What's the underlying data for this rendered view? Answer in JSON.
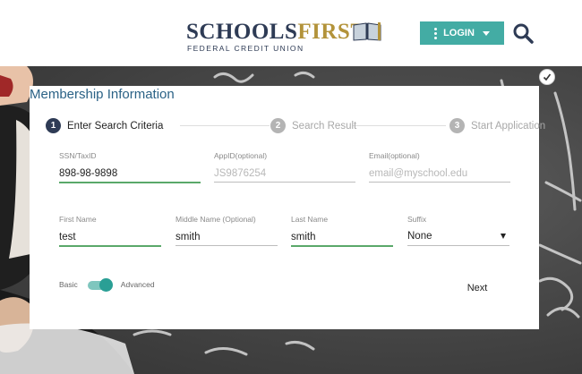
{
  "brand": {
    "name_part1": "SCHOOLS",
    "name_part2": "FIRST",
    "subtitle": "FEDERAL CREDIT UNION",
    "color_primary": "#2e3b55",
    "color_gold": "#b3933a"
  },
  "header": {
    "login_label": "LOGIN",
    "login_color": "#43aca4",
    "search_icon": "search-icon"
  },
  "form": {
    "title": "Membership Information",
    "steps": [
      {
        "number": "1",
        "label": "Enter Search Criteria",
        "state": "active"
      },
      {
        "number": "2",
        "label": "Search Result",
        "state": "inactive"
      },
      {
        "number": "3",
        "label": "Start Application",
        "state": "inactive"
      }
    ],
    "fields": {
      "ssn": {
        "label": "SSN/TaxID",
        "value": "898-98-9898"
      },
      "appid": {
        "label": "AppID(optional)",
        "placeholder": "JS9876254"
      },
      "email": {
        "label": "Email(optional)",
        "placeholder": "email@myschool.edu"
      },
      "first_name": {
        "label": "First Name",
        "value": "test"
      },
      "middle_name": {
        "label": "Middle Name (Optional)",
        "value": "smith"
      },
      "last_name": {
        "label": "Last Name",
        "value": "smith"
      },
      "suffix": {
        "label": "Suffix",
        "value": "None"
      }
    },
    "toggle": {
      "left_label": "Basic",
      "right_label": "Advanced",
      "checked": true
    },
    "next_label": "Next"
  }
}
